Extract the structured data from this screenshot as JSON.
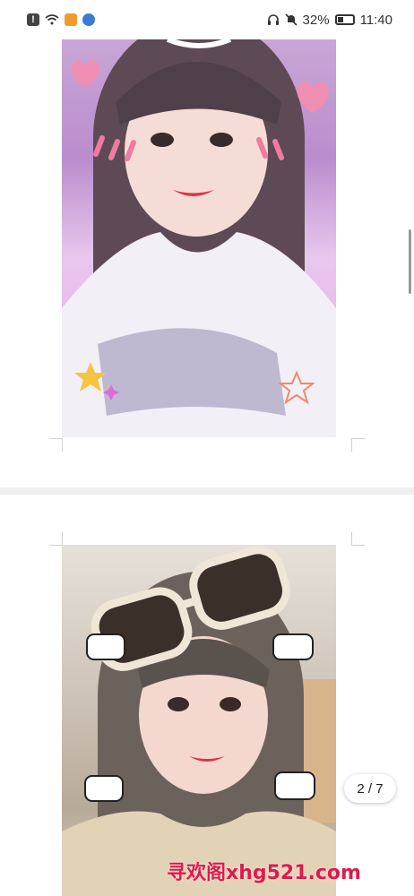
{
  "status_bar": {
    "battery_percent": "32%",
    "time": "11:40"
  },
  "viewer": {
    "page_indicator": "2 / 7"
  },
  "watermark": "寻欢阁xhg521.com"
}
